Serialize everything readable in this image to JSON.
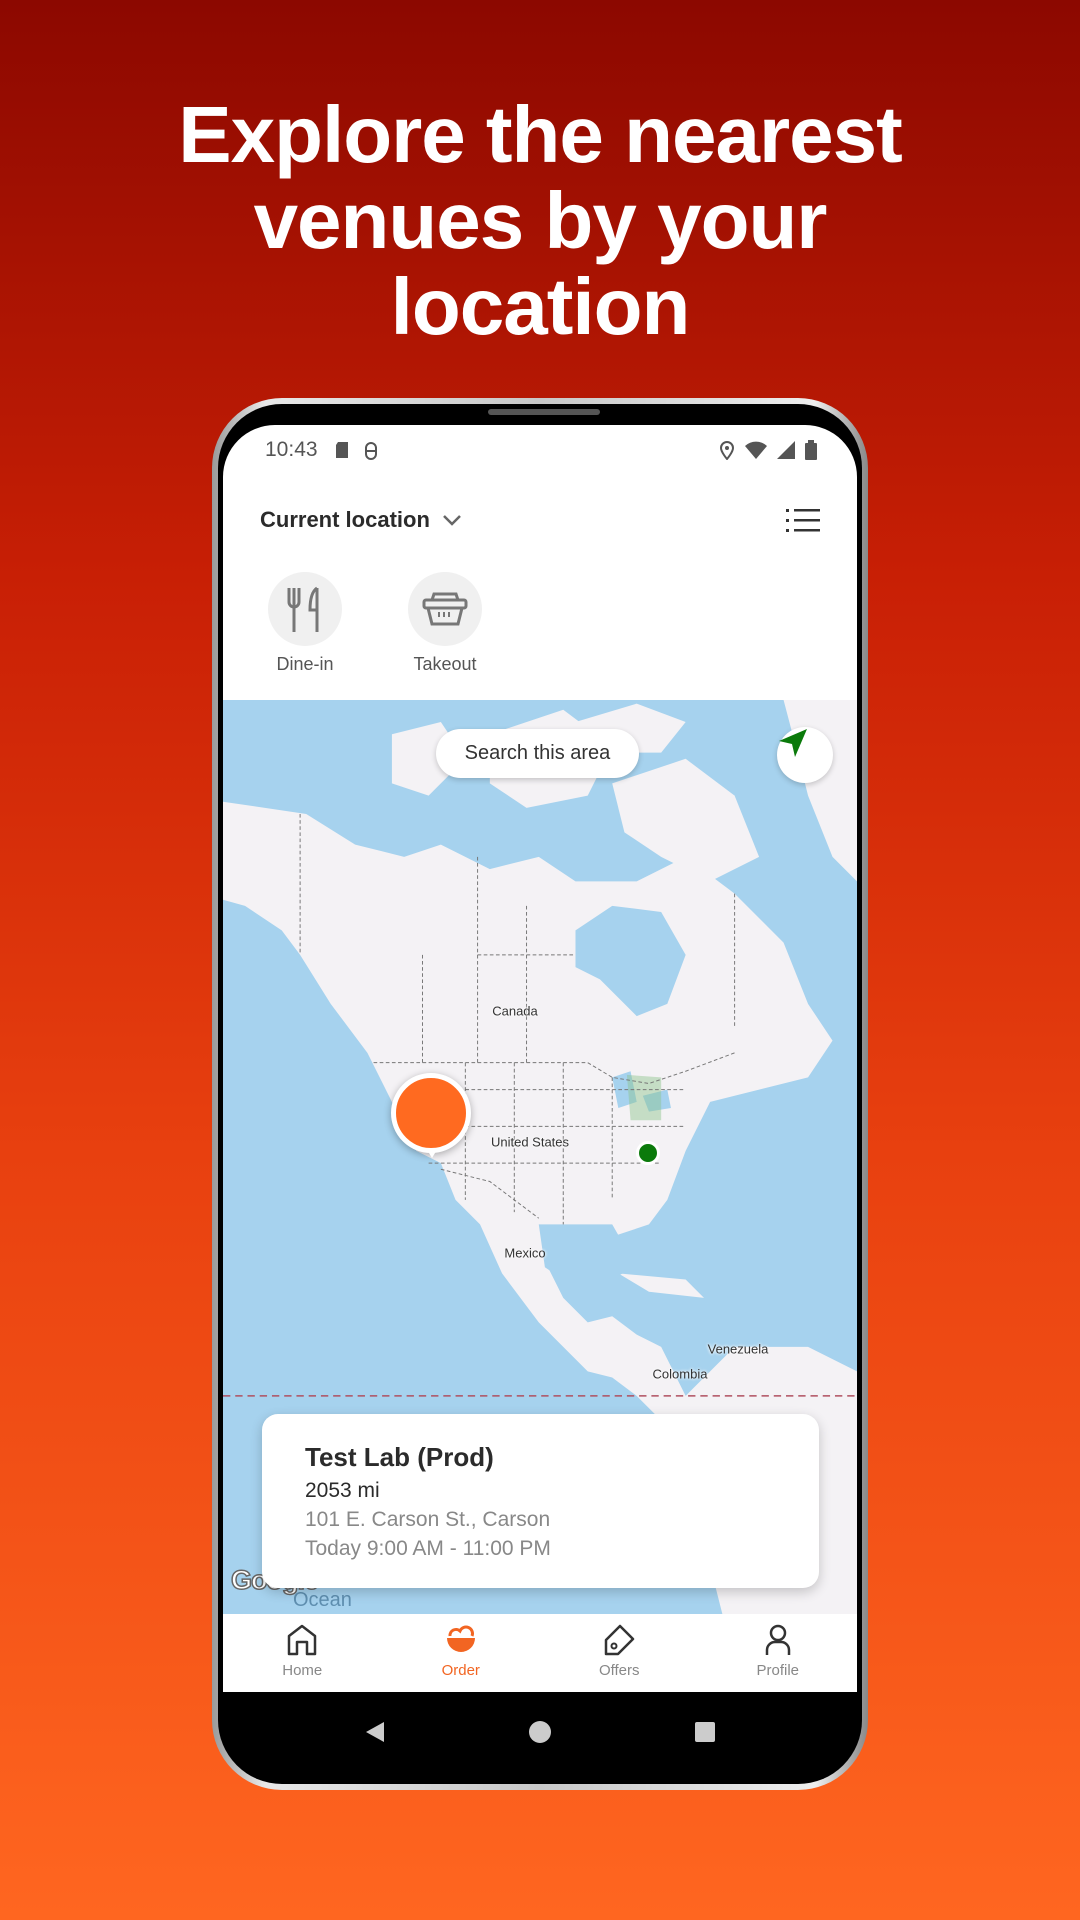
{
  "headline": {
    "line1": "Explore the nearest",
    "line2": "venues by your",
    "line3": "location"
  },
  "status_bar": {
    "time": "10:43",
    "icons": [
      "sd-card-icon",
      "android-debug-icon",
      "location-pin-icon",
      "wifi-icon",
      "signal-icon",
      "battery-icon"
    ]
  },
  "header": {
    "location_label": "Current location",
    "list_icon": "list-icon"
  },
  "categories": [
    {
      "label": "Dine-in",
      "icon": "fork-knife-icon"
    },
    {
      "label": "Takeout",
      "icon": "takeout-box-icon"
    }
  ],
  "map": {
    "search_area_label": "Search this area",
    "labels": {
      "canada": "Canada",
      "us": "United States",
      "mexico": "Mexico",
      "venezuela": "Venezuela",
      "colombia": "Colombia",
      "ocean": "Ocean"
    },
    "attribution": "Google",
    "marker_color": "#ff6a20",
    "user_dot_color": "#0b7a0b"
  },
  "venue_card": {
    "name": "Test Lab (Prod)",
    "distance": "2053 mi",
    "address": "101 E. Carson St., Carson",
    "hours": "Today 9:00 AM - 11:00 PM"
  },
  "bottom_nav": [
    {
      "label": "Home",
      "icon": "home-icon"
    },
    {
      "label": "Order",
      "icon": "order-bowl-icon",
      "active": true
    },
    {
      "label": "Offers",
      "icon": "tag-icon"
    },
    {
      "label": "Profile",
      "icon": "person-icon"
    }
  ],
  "colors": {
    "accent": "#f26522",
    "background_top": "#8c0800",
    "background_bottom": "#ff6620"
  }
}
